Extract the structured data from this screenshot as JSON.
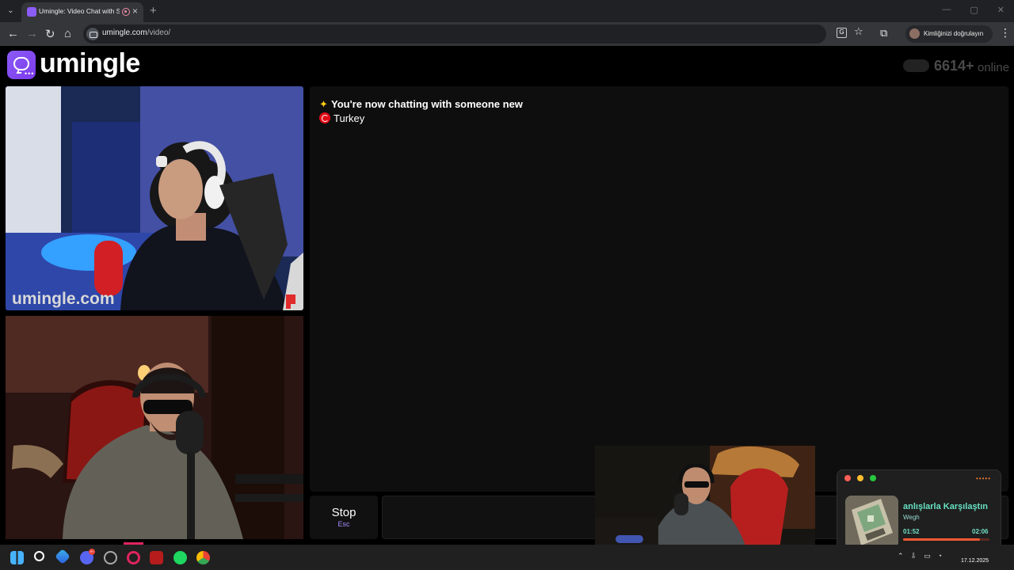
{
  "browser": {
    "tab_title": "Umingle: Video Chat with S",
    "tab_close_icon": "×",
    "new_tab_icon": "+",
    "url_domain": "umingle.com",
    "url_path": "/video/",
    "profile_label": "Kimliğinizi doğrulayın",
    "nav": {
      "back": "←",
      "forward": "→",
      "reload": "↻",
      "home": "⌂",
      "star": "☆",
      "extensions": "⧉",
      "menu": "⋮",
      "translate": "G"
    },
    "window_controls": [
      "—",
      "▢",
      "✕"
    ]
  },
  "app": {
    "brand": "umingle",
    "online_count": "6614+",
    "online_label": "online",
    "chat_status": "You're now chatting with someone new",
    "country": "Turkey",
    "stop_label": "Stop",
    "stop_key": "Esc",
    "watermark": "umingle.com"
  },
  "music": {
    "title": "anlışlarla Karşılaştın",
    "artist": "Wegh",
    "current_time": "01:52",
    "total_time": "02:06",
    "progress": 0.89,
    "dots": "•••••"
  },
  "taskbar": {
    "date": "17.12.2025",
    "discord_badge": "9+"
  }
}
